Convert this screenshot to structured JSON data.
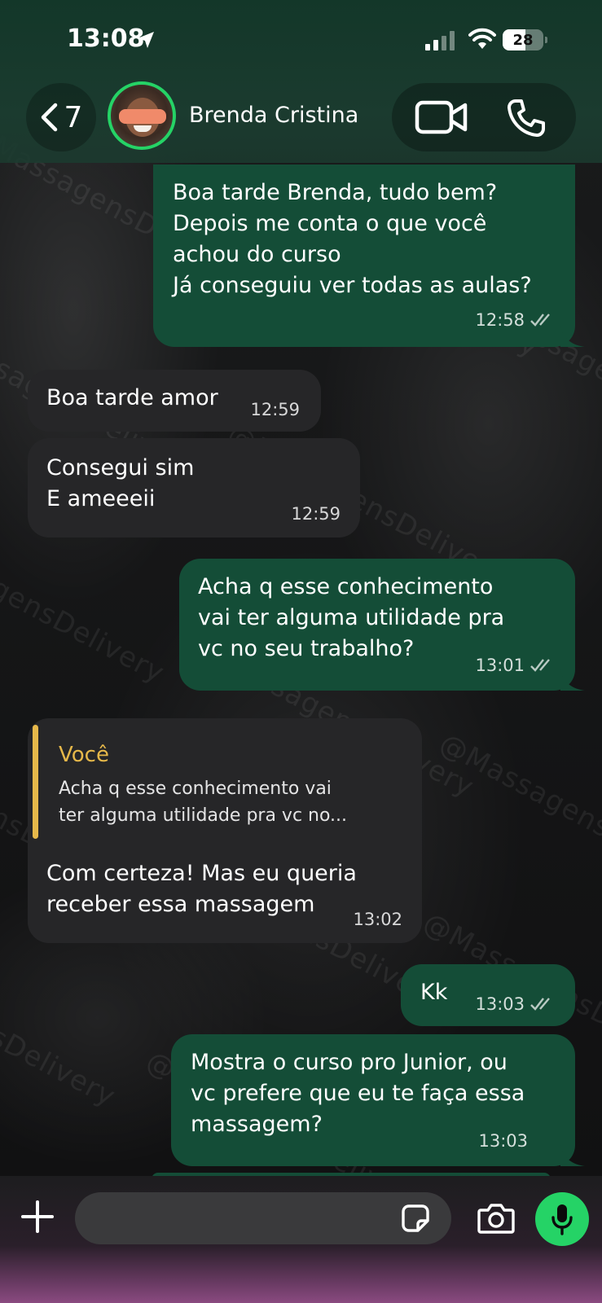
{
  "status_bar": {
    "time": "13:08",
    "battery": "28"
  },
  "header": {
    "back_count": "7",
    "contact_name": "Brenda Cristina"
  },
  "messages": [
    {
      "direction": "out",
      "text": "Boa tarde Brenda, tudo bem?\nDepois me conta o que você\nachou do curso\nJá conseguiu ver todas as aulas?",
      "time": "12:58",
      "read": true
    },
    {
      "direction": "in",
      "text": "Boa tarde amor",
      "time": "12:59"
    },
    {
      "direction": "in",
      "text": "Consegui sim\nE ameeeii",
      "time": "12:59"
    },
    {
      "direction": "out",
      "text": "Acha q esse conhecimento\nvai ter alguma utilidade pra\nvc no seu trabalho?",
      "time": "13:01",
      "read": true
    },
    {
      "direction": "in",
      "reply_author": "Você",
      "reply_text": "Acha q esse conhecimento vai\nter alguma utilidade pra vc no...",
      "text": "Com certeza! Mas eu queria\nreceber essa massagem",
      "time": "13:02"
    },
    {
      "direction": "out",
      "text": "Kk",
      "time": "13:03",
      "read": true
    },
    {
      "direction": "out",
      "text": "Mostra o curso pro Junior, ou\nvc prefere que eu te faça essa\nmassagem?",
      "time": "13:03"
    }
  ],
  "watermark": "@MassagensDelivery",
  "composer": {
    "placeholder": ""
  },
  "colors": {
    "accent": "#25d366",
    "outgoing_bubble": "#144d37",
    "incoming_bubble": "#262628",
    "reply_bar": "#e6b84a"
  }
}
